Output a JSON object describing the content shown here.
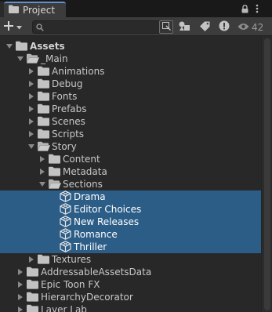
{
  "window": {
    "tab_title": "Project",
    "tab_icon": "folder-icon",
    "menu_icon": "kebab-menu-icon",
    "lock_icon": "lock-icon"
  },
  "toolbar": {
    "create_icon": "plus-icon",
    "search": {
      "value": "",
      "placeholder": ""
    },
    "hidden_count": "42"
  },
  "tree": [
    {
      "label": "Assets",
      "depth": 0,
      "expand": "open",
      "icon": "folder-icon",
      "bold": true,
      "selected": false
    },
    {
      "label": "_Main",
      "depth": 1,
      "expand": "open",
      "icon": "folder-open-icon",
      "bold": false,
      "selected": false
    },
    {
      "label": "Animations",
      "depth": 2,
      "expand": "closed",
      "icon": "folder-icon",
      "bold": false,
      "selected": false
    },
    {
      "label": "Debug",
      "depth": 2,
      "expand": "closed",
      "icon": "folder-icon",
      "bold": false,
      "selected": false
    },
    {
      "label": "Fonts",
      "depth": 2,
      "expand": "closed",
      "icon": "folder-icon",
      "bold": false,
      "selected": false
    },
    {
      "label": "Prefabs",
      "depth": 2,
      "expand": "closed",
      "icon": "folder-icon",
      "bold": false,
      "selected": false
    },
    {
      "label": "Scenes",
      "depth": 2,
      "expand": "closed",
      "icon": "folder-icon",
      "bold": false,
      "selected": false
    },
    {
      "label": "Scripts",
      "depth": 2,
      "expand": "closed",
      "icon": "folder-icon",
      "bold": false,
      "selected": false
    },
    {
      "label": "Story",
      "depth": 2,
      "expand": "open",
      "icon": "folder-open-icon",
      "bold": false,
      "selected": false
    },
    {
      "label": "Content",
      "depth": 3,
      "expand": "closed",
      "icon": "folder-icon",
      "bold": false,
      "selected": false
    },
    {
      "label": "Metadata",
      "depth": 3,
      "expand": "closed",
      "icon": "folder-icon",
      "bold": false,
      "selected": false
    },
    {
      "label": "Sections",
      "depth": 3,
      "expand": "open",
      "icon": "folder-open-icon",
      "bold": false,
      "selected": false
    },
    {
      "label": "Drama",
      "depth": 4,
      "expand": "none",
      "icon": "prefab-cube-icon",
      "bold": false,
      "selected": true
    },
    {
      "label": "Editor Choices",
      "depth": 4,
      "expand": "none",
      "icon": "prefab-cube-icon",
      "bold": false,
      "selected": true
    },
    {
      "label": "New Releases",
      "depth": 4,
      "expand": "none",
      "icon": "prefab-cube-icon",
      "bold": false,
      "selected": true
    },
    {
      "label": "Romance",
      "depth": 4,
      "expand": "none",
      "icon": "prefab-cube-icon",
      "bold": false,
      "selected": true
    },
    {
      "label": "Thriller",
      "depth": 4,
      "expand": "none",
      "icon": "prefab-cube-icon",
      "bold": false,
      "selected": true
    },
    {
      "label": "Textures",
      "depth": 2,
      "expand": "closed",
      "icon": "folder-icon",
      "bold": false,
      "selected": false
    },
    {
      "label": "AddressableAssetsData",
      "depth": 1,
      "expand": "closed",
      "icon": "folder-icon",
      "bold": false,
      "selected": false
    },
    {
      "label": "Epic Toon FX",
      "depth": 1,
      "expand": "closed",
      "icon": "folder-icon",
      "bold": false,
      "selected": false
    },
    {
      "label": "HierarchyDecorator",
      "depth": 1,
      "expand": "closed",
      "icon": "folder-icon",
      "bold": false,
      "selected": false
    },
    {
      "label": "Layer Lab",
      "depth": 1,
      "expand": "closed",
      "icon": "folder-icon",
      "bold": false,
      "selected": false
    }
  ]
}
